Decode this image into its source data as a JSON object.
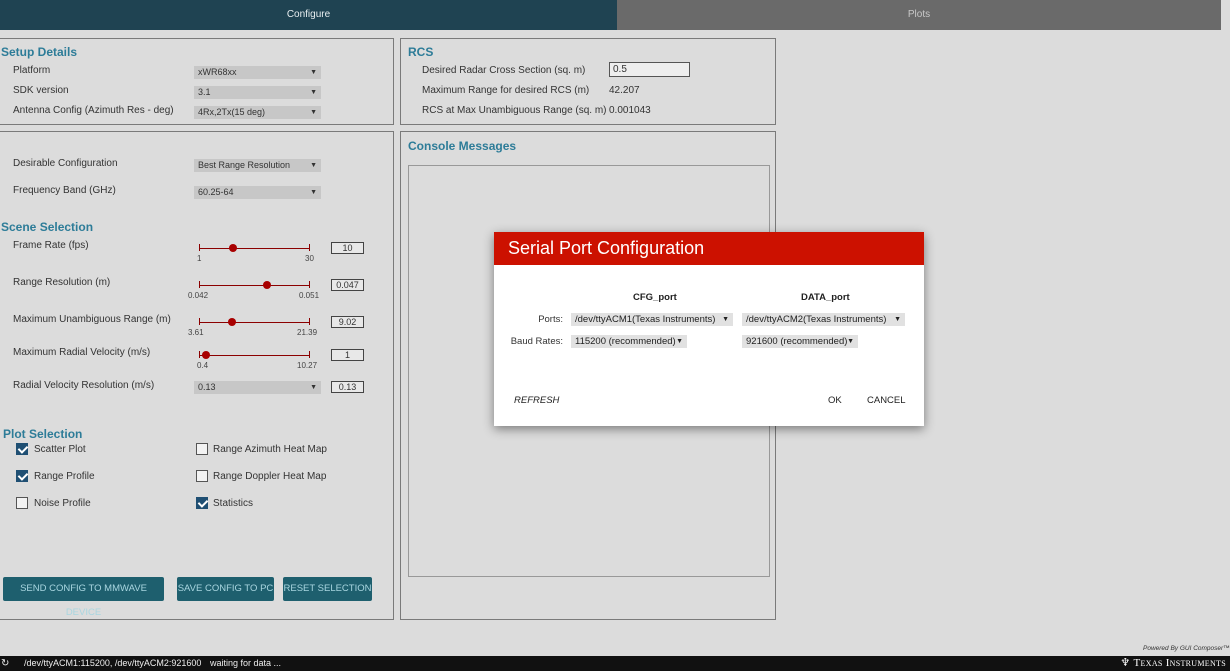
{
  "tabs": [
    {
      "label": "Configure",
      "active": true
    },
    {
      "label": "Plots",
      "active": false
    }
  ],
  "setup": {
    "title": "Setup Details",
    "rows": [
      {
        "label": "Platform",
        "value": "xWR68xx"
      },
      {
        "label": "SDK version",
        "value": "3.1"
      },
      {
        "label": "Antenna Config (Azimuth Res - deg)",
        "value": "4Rx,2Tx(15 deg)"
      }
    ]
  },
  "config": {
    "desirable_label": "Desirable Configuration",
    "desirable_value": "Best Range Resolution",
    "freq_label": "Frequency Band (GHz)",
    "freq_value": "60.25-64"
  },
  "scene": {
    "title": "Scene Selection",
    "sliders": [
      {
        "label": "Frame Rate (fps)",
        "min": "1",
        "max": "30",
        "value": "10",
        "fraction": 0.31
      },
      {
        "label": "Range Resolution (m)",
        "min": "0.042",
        "max": "0.051",
        "value": "0.047",
        "fraction": 0.62
      },
      {
        "label": "Maximum Unambiguous Range (m)",
        "min": "3.61",
        "max": "21.39",
        "value": "9.02",
        "fraction": 0.3
      },
      {
        "label": "Maximum Radial Velocity (m/s)",
        "min": "0.4",
        "max": "10.27",
        "value": "1",
        "fraction": 0.06
      }
    ],
    "velres_label": "Radial Velocity Resolution (m/s)",
    "velres_select": "0.13",
    "velres_value": "0.13"
  },
  "plot_selection": {
    "title": "Plot Selection",
    "items": [
      {
        "label": "Scatter Plot",
        "checked": true
      },
      {
        "label": "Range Azimuth Heat Map",
        "checked": false
      },
      {
        "label": "Range Profile",
        "checked": true
      },
      {
        "label": "Range Doppler Heat Map",
        "checked": false
      },
      {
        "label": "Noise Profile",
        "checked": false
      },
      {
        "label": "Statistics",
        "checked": true
      }
    ]
  },
  "buttons": {
    "send": "SEND CONFIG TO MMWAVE DEVICE",
    "save": "SAVE CONFIG TO PC",
    "reset": "RESET SELECTION"
  },
  "rcs": {
    "title": "RCS",
    "desired_label": "Desired Radar Cross Section (sq. m)",
    "desired_value": "0.5",
    "maxrange_label": "Maximum Range for desired RCS (m)",
    "maxrange_value": "42.207",
    "rcsmax_label": "RCS at Max Unambiguous Range (sq. m)",
    "rcsmax_value": "0.001043"
  },
  "console": {
    "title": "Console Messages"
  },
  "modal": {
    "title": "Serial Port Configuration",
    "cfg_header": "CFG_port",
    "data_header": "DATA_port",
    "ports_label": "Ports:",
    "baud_label": "Baud Rates:",
    "cfg_port": "/dev/ttyACM1(Texas Instruments)",
    "data_port": "/dev/ttyACM2(Texas Instruments)",
    "cfg_baud": "115200 (recommended)",
    "data_baud": "921600 (recommended)",
    "refresh": "REFRESH",
    "ok": "OK",
    "cancel": "CANCEL"
  },
  "status": {
    "ports": "/dev/ttyACM1:115200, /dev/ttyACM2:921600",
    "message": "waiting for data ...",
    "powered": "Powered By GUI Composer™",
    "brand": "Texas Instruments"
  },
  "colors": {
    "accent_title": "#2d7c98",
    "tab_active": "#1f4352",
    "modal_header": "#cc1100",
    "button": "#1e5f6e"
  }
}
